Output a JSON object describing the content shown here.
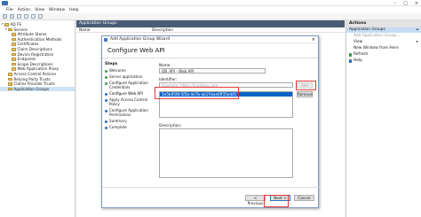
{
  "menu": [
    "File",
    "Action",
    "View",
    "Window",
    "Help"
  ],
  "tree": {
    "items": [
      {
        "label": "AD FS",
        "level": 0
      },
      {
        "label": "Service",
        "level": 1
      },
      {
        "label": "Attribute Stores",
        "level": 2
      },
      {
        "label": "Authentication Methods",
        "level": 2
      },
      {
        "label": "Certificates",
        "level": 2
      },
      {
        "label": "Claim Descriptions",
        "level": 2
      },
      {
        "label": "Device Registration",
        "level": 2
      },
      {
        "label": "Endpoints",
        "level": 2
      },
      {
        "label": "Scope Descriptions",
        "level": 2
      },
      {
        "label": "Web Application Proxy",
        "level": 2
      },
      {
        "label": "Access Control Policies",
        "level": 1
      },
      {
        "label": "Relying Party Trusts",
        "level": 1
      },
      {
        "label": "Claims Provider Trusts",
        "level": 1
      },
      {
        "label": "Application Groups",
        "level": 1,
        "selected": true
      }
    ]
  },
  "center": {
    "header": "Application Groups",
    "col_name": "Name",
    "col_description": "Description"
  },
  "actions": {
    "header": "Actions",
    "sub": "Application Groups",
    "items": [
      {
        "label": "Add Application Group...",
        "disabled": true
      },
      {
        "label": "View"
      },
      {
        "label": "New Window from Here"
      },
      {
        "label": "Refresh"
      },
      {
        "label": "Help"
      }
    ]
  },
  "wizard": {
    "title": "Add Application Group Wizard",
    "close_glyph": "×",
    "heading": "Configure Web API",
    "steps_title": "Steps",
    "steps": [
      {
        "label": "Welcome",
        "state": "done"
      },
      {
        "label": "Server application",
        "state": "done"
      },
      {
        "label": "Configure Application Credentials",
        "state": "done"
      },
      {
        "label": "Configure Web API",
        "state": "current"
      },
      {
        "label": "Apply Access Control Policy",
        "state": "pending"
      },
      {
        "label": "Configure Application Permissions",
        "state": "pending"
      },
      {
        "label": "Summary",
        "state": "pending"
      },
      {
        "label": "Complete",
        "state": "pending"
      }
    ],
    "name_label": "Name:",
    "name_value": "OB_API - Web API",
    "identifier_label": "Identifier:",
    "identifier_placeholder": "Example: https://Contoso.com",
    "add_button": "Add",
    "identifier_selected": "5e5b95f8-5f5b-4e7b-ab1f-bae6ff35ed45",
    "remove_button": "Remove",
    "description_label": "Description:",
    "previous_button": "< Previous",
    "next_button": "Next >",
    "cancel_button": "Cancel"
  },
  "colors": {
    "highlight": "#e03a3a",
    "header_bar": "#4a5b77",
    "selection": "#0a62c7"
  }
}
